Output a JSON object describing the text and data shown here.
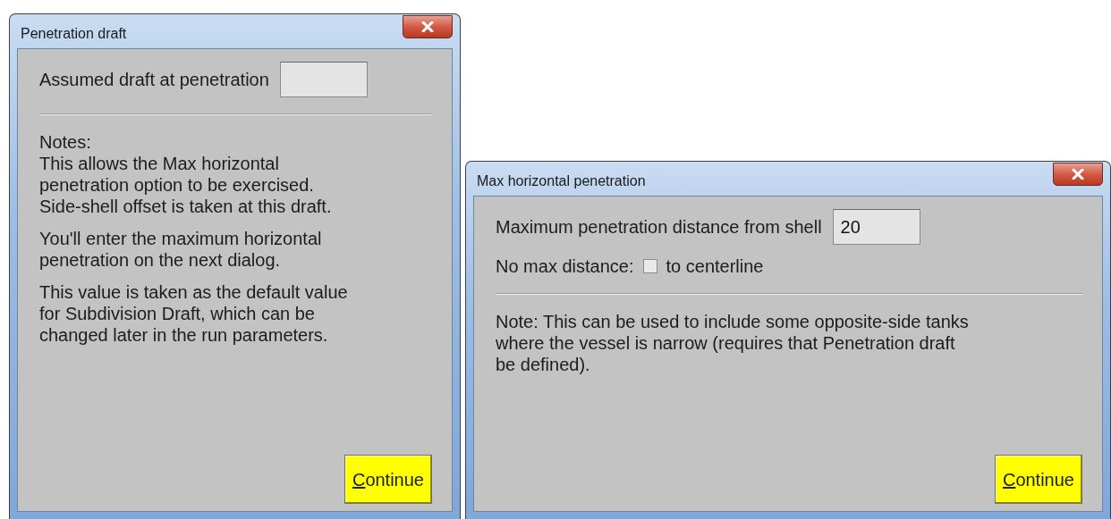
{
  "dialogs": [
    {
      "title": "Penetration draft",
      "rows": [
        {
          "kind": "field",
          "label": "Assumed draft at penetration",
          "value": ""
        }
      ],
      "notes": [
        "Notes:\nThis allows the Max horizontal\npenetration option to be exercised.\nSide-shell offset is taken at this draft.",
        "You'll enter the maximum horizontal\npenetration on the next dialog.",
        "This value is taken as the default value\nfor Subdivision Draft, which can be\nchanged later in the run parameters."
      ],
      "button": {
        "access_key": "C",
        "label_after": "ontinue"
      }
    },
    {
      "title": "Max horizontal penetration",
      "rows": [
        {
          "kind": "field",
          "label": "Maximum penetration distance from shell",
          "value": "20"
        },
        {
          "kind": "checkbox",
          "label": "No max distance:",
          "after": "to centerline",
          "checked": false
        }
      ],
      "notes": [
        "Note: This can be used to include some opposite-side tanks\nwhere the vessel is narrow (requires that Penetration draft\nbe defined)."
      ],
      "button": {
        "access_key": "C",
        "label_after": "ontinue"
      }
    }
  ]
}
